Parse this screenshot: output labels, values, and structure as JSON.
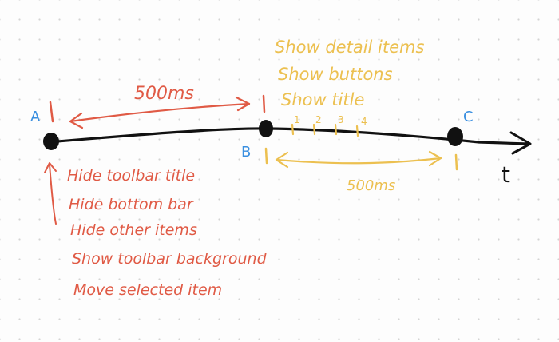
{
  "timeline": {
    "axis_label": "t",
    "points": [
      {
        "id": "A",
        "label": "A",
        "color": "#3a8fe0"
      },
      {
        "id": "B",
        "label": "B",
        "color": "#3a8fe0"
      },
      {
        "id": "C",
        "label": "C",
        "color": "#3a8fe0"
      }
    ],
    "ticks": [
      "1",
      "2",
      "3",
      "4"
    ]
  },
  "segment_ab": {
    "duration_label": "500ms",
    "color": "#e05a45"
  },
  "segment_bc": {
    "duration_label": "500ms",
    "color": "#ecc050"
  },
  "actions_at_a": {
    "color": "#e05a45",
    "items": [
      "Hide toolbar title",
      "Hide bottom bar",
      "Hide other items",
      "Show toolbar background",
      "Move selected item"
    ]
  },
  "actions_at_b": {
    "color": "#ecc050",
    "items": [
      "Show detail items",
      "Show buttons",
      "Show title"
    ]
  }
}
